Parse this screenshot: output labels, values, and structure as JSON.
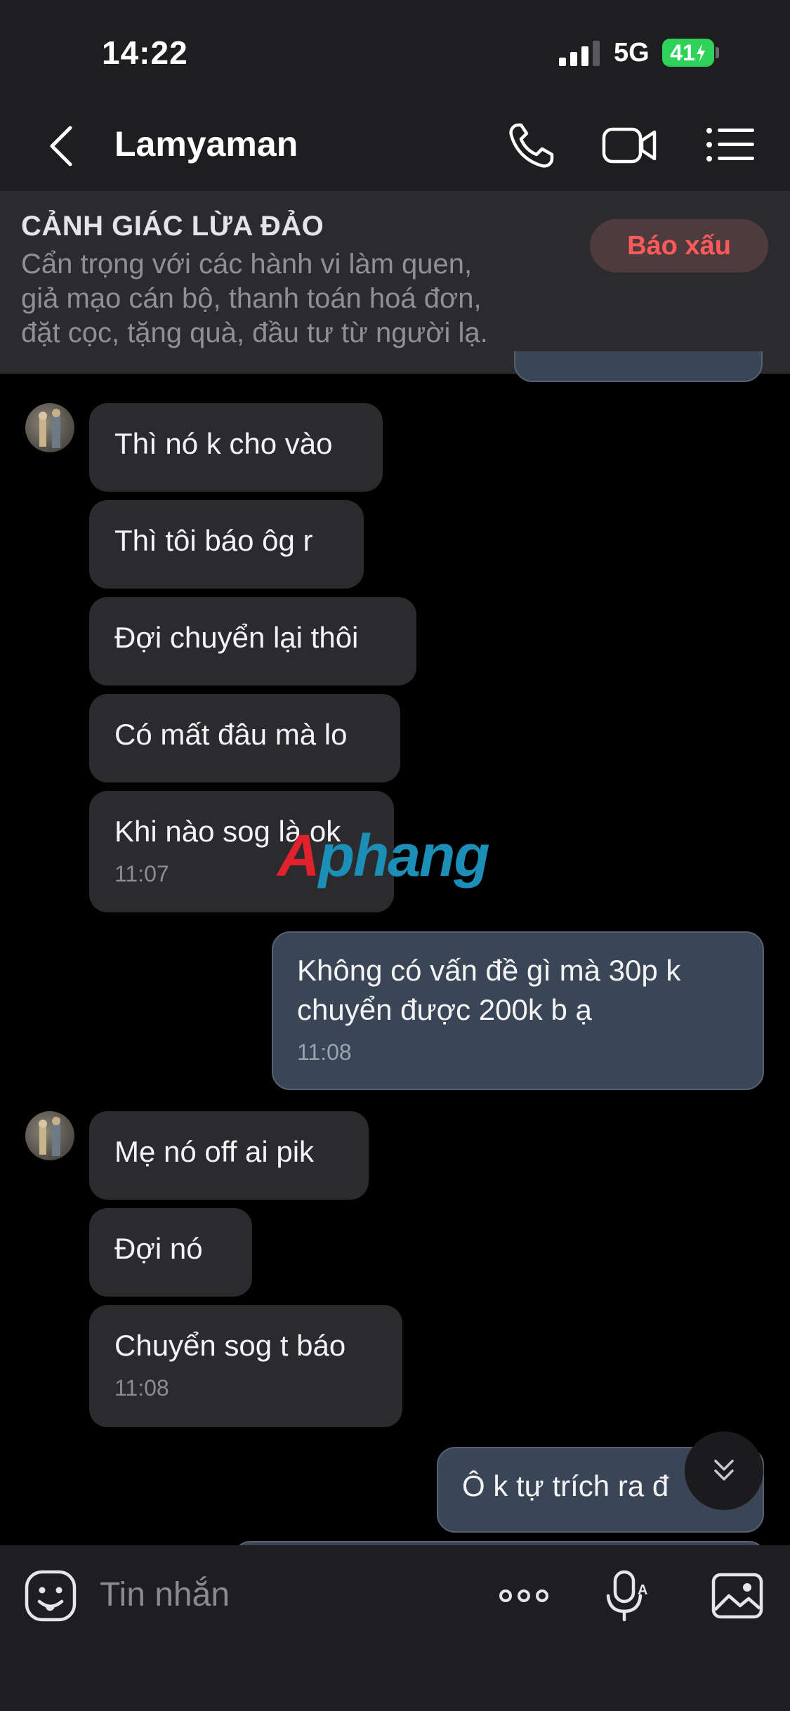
{
  "status_bar": {
    "time": "14:22",
    "network": "5G",
    "battery": "41"
  },
  "header": {
    "title": "Lamyaman"
  },
  "warning": {
    "title": "CẢNH GIÁC LỪA ĐẢO",
    "lines": [
      "Cẩn trọng với các hành vi làm quen,",
      "giả mạo cán bộ, thanh toán hoá đơn,",
      "đặt cọc, tặng quà, đầu tư từ người lạ."
    ],
    "report_label": "Báo xấu"
  },
  "messages": [
    {
      "text": "Thì nó k cho vào"
    },
    {
      "text": "Thì tôi báo ôg r"
    },
    {
      "text": "Đợi chuyển lại thôi"
    },
    {
      "text": "Có mất đâu mà lo"
    },
    {
      "text": "Khi nào sog là ok",
      "time": "11:07"
    },
    {
      "text": "Không có vấn đề gì mà 30p k\nchuyển được 200k b ạ",
      "time": "11:08"
    },
    {
      "text": "Mẹ nó off ai pik"
    },
    {
      "text": "Đợi nó"
    },
    {
      "text": "Chuyển sog t báo",
      "time": "11:08"
    },
    {
      "text": "Ô k tự trích ra đ"
    }
  ],
  "watermark": {
    "first": "A",
    "rest": "phang"
  },
  "composer": {
    "placeholder": "Tin nhắn"
  }
}
